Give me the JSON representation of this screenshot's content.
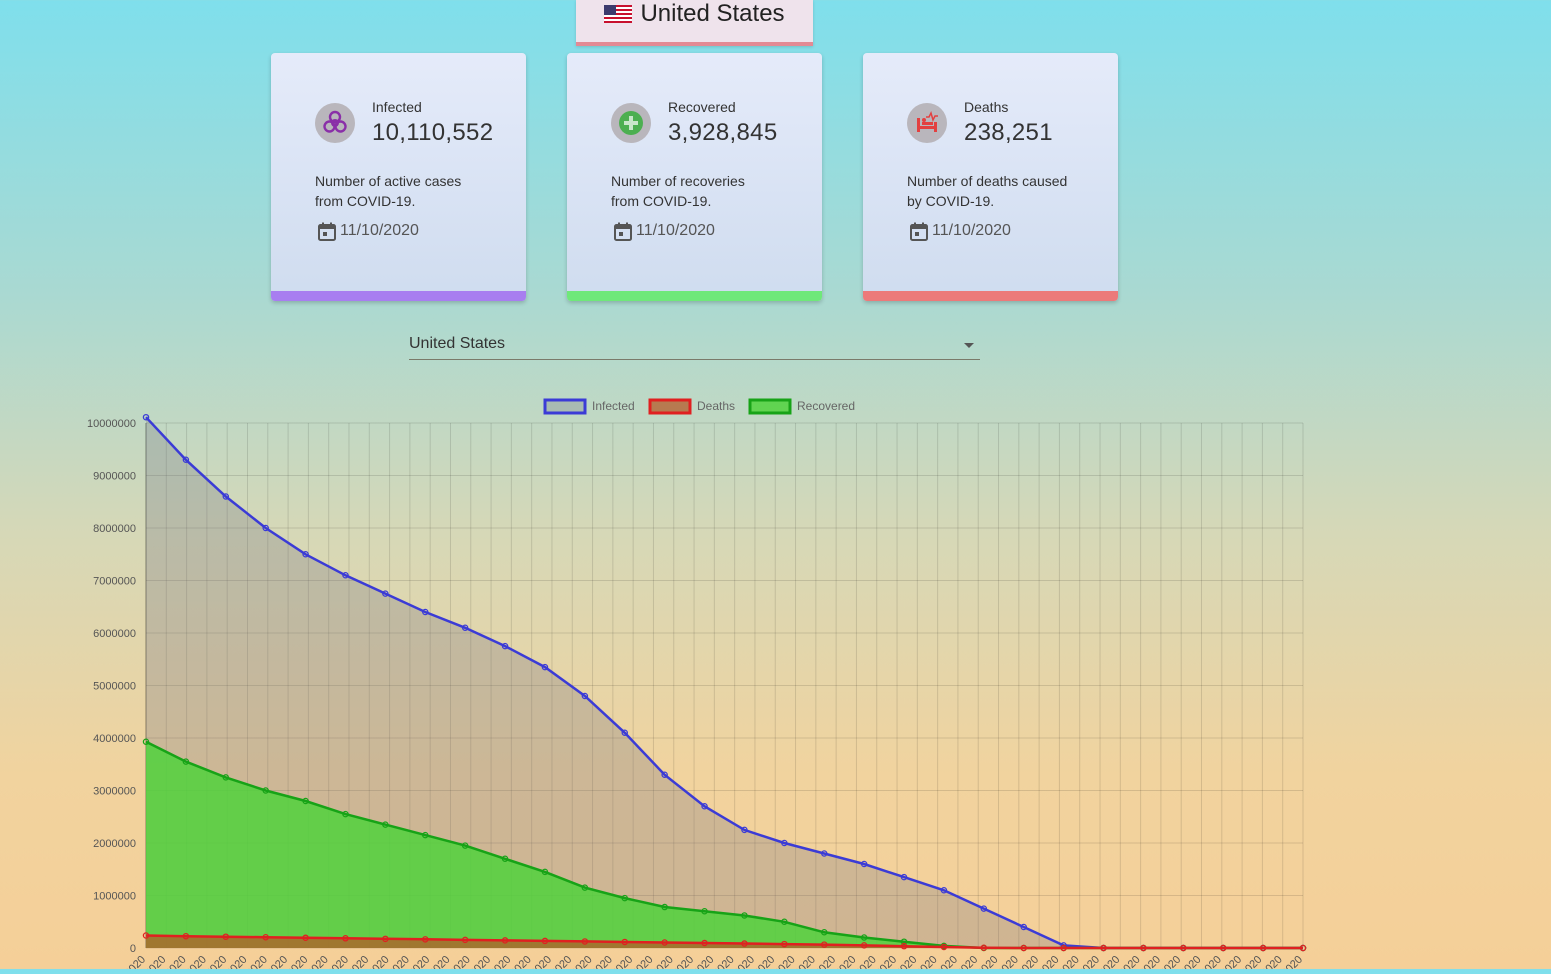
{
  "header": {
    "country": "United States",
    "flag_icon": "us-flag-icon"
  },
  "cards": [
    {
      "id": "infected",
      "label": "Infected",
      "value": "10,110,552",
      "desc_line1": "Number of active cases",
      "desc_line2": "from COVID-19.",
      "date": "11/10/2020",
      "icon": "biohazard-icon",
      "accent": "#a87ef0",
      "icon_color": "#8a2fa8"
    },
    {
      "id": "recovered",
      "label": "Recovered",
      "value": "3,928,845",
      "desc_line1": "Number of recoveries",
      "desc_line2": "from COVID-19.",
      "date": "11/10/2020",
      "icon": "medical-cross-icon",
      "accent": "#6fe87a",
      "icon_color": "#4caf50"
    },
    {
      "id": "deaths",
      "label": "Deaths",
      "value": "238,251",
      "desc_line1": "Number of deaths caused",
      "desc_line2": "by COVID-19.",
      "date": "11/10/2020",
      "icon": "hospital-bed-icon",
      "accent": "#ec7a7a",
      "icon_color": "#e34040"
    }
  ],
  "country_select": {
    "value": "United States"
  },
  "chart_data": {
    "type": "area",
    "ylim": [
      0,
      10000000
    ],
    "y_ticks": [
      "10000000",
      "9000000",
      "8000000",
      "7000000",
      "6000000",
      "5000000",
      "4000000",
      "3000000",
      "2000000",
      "1000000",
      "0"
    ],
    "x_tick_label": "2020",
    "x_tick_count": 58,
    "grid": true,
    "legend_position": "top",
    "series": [
      {
        "name": "Infected",
        "color": "#3b3bd6",
        "fill": "rgba(110,110,130,0.28)",
        "values": [
          10110552,
          9300000,
          8600000,
          8000000,
          7500000,
          7100000,
          6750000,
          6400000,
          6100000,
          5750000,
          5350000,
          4800000,
          4100000,
          3300000,
          2700000,
          2250000,
          2000000,
          1800000,
          1600000,
          1350000,
          1100000,
          750000,
          400000,
          50000,
          0,
          0,
          0,
          0,
          0,
          0
        ]
      },
      {
        "name": "Deaths",
        "color": "#e02020",
        "fill": "rgba(180,90,40,0.75)",
        "values": [
          238251,
          225000,
          215000,
          205000,
          195000,
          185000,
          175000,
          165000,
          155000,
          145000,
          135000,
          125000,
          115000,
          105000,
          95000,
          85000,
          75000,
          65000,
          50000,
          35000,
          20000,
          5000,
          0,
          0,
          0,
          0,
          0,
          0,
          0,
          0
        ]
      },
      {
        "name": "Recovered",
        "color": "#17a317",
        "fill": "rgba(80,210,60,0.85)",
        "values": [
          3928845,
          3550000,
          3250000,
          3000000,
          2800000,
          2550000,
          2350000,
          2150000,
          1950000,
          1700000,
          1450000,
          1150000,
          950000,
          780000,
          700000,
          620000,
          500000,
          300000,
          200000,
          120000,
          40000,
          0,
          0,
          0,
          0,
          0,
          0,
          0,
          0,
          0
        ]
      }
    ]
  }
}
